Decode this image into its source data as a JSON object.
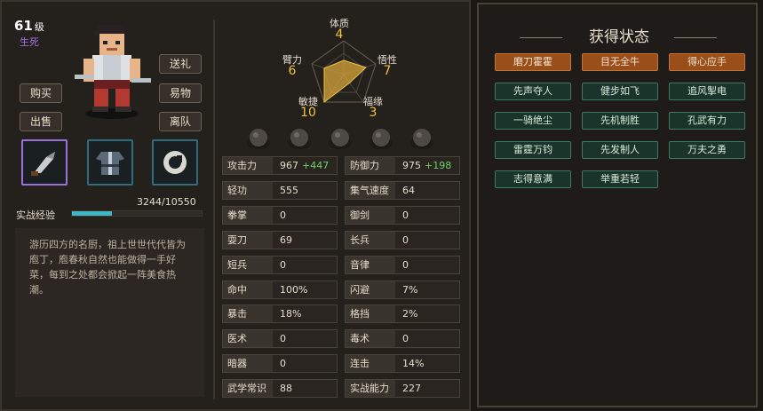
{
  "character": {
    "level": "61",
    "level_unit": "级",
    "status": "生死"
  },
  "buttons": {
    "gift": "送礼",
    "buy": "购买",
    "trade": "易物",
    "sell": "出售",
    "leave": "离队"
  },
  "experience": {
    "label": "实战经验",
    "current": 3244,
    "max": 10550,
    "text": "3244/10550",
    "fill_fraction": 0.307
  },
  "bio": "游历四方的名厨，祖上世世代代皆为庖丁，庖春秋自然也能做得一手好菜，每到之处都会掀起一阵美食热潮。",
  "radar": [
    {
      "label": "体质",
      "value": "4"
    },
    {
      "label": "悟性",
      "value": "7"
    },
    {
      "label": "福缘",
      "value": "3"
    },
    {
      "label": "敏捷",
      "value": "10"
    },
    {
      "label": "臂力",
      "value": "6"
    }
  ],
  "stats_left": [
    {
      "label": "攻击力",
      "value": "967",
      "bonus": "+447"
    },
    {
      "label": "轻功",
      "value": "555",
      "bonus": ""
    },
    {
      "label": "拳掌",
      "value": "0",
      "bonus": ""
    },
    {
      "label": "耍刀",
      "value": "69",
      "bonus": ""
    },
    {
      "label": "短兵",
      "value": "0",
      "bonus": ""
    },
    {
      "label": "命中",
      "value": "100%",
      "bonus": ""
    },
    {
      "label": "暴击",
      "value": "18%",
      "bonus": ""
    },
    {
      "label": "医术",
      "value": "0",
      "bonus": ""
    },
    {
      "label": "暗器",
      "value": "0",
      "bonus": ""
    },
    {
      "label": "武学常识",
      "value": "88",
      "bonus": ""
    }
  ],
  "stats_right": [
    {
      "label": "防御力",
      "value": "975",
      "bonus": "+198"
    },
    {
      "label": "集气速度",
      "value": "64",
      "bonus": ""
    },
    {
      "label": "御剑",
      "value": "0",
      "bonus": ""
    },
    {
      "label": "长兵",
      "value": "0",
      "bonus": ""
    },
    {
      "label": "音律",
      "value": "0",
      "bonus": ""
    },
    {
      "label": "闪避",
      "value": "7%",
      "bonus": ""
    },
    {
      "label": "格挡",
      "value": "2%",
      "bonus": ""
    },
    {
      "label": "毒术",
      "value": "0",
      "bonus": ""
    },
    {
      "label": "连击",
      "value": "14%",
      "bonus": ""
    },
    {
      "label": "实战能力",
      "value": "227",
      "bonus": ""
    }
  ],
  "status_panel": {
    "title": "获得状态",
    "tags": [
      {
        "label": "磨刀霍霍",
        "color": "orange"
      },
      {
        "label": "目无全牛",
        "color": "orange"
      },
      {
        "label": "得心应手",
        "color": "orange"
      },
      {
        "label": "先声夺人",
        "color": "green"
      },
      {
        "label": "健步如飞",
        "color": "green"
      },
      {
        "label": "追风掣电",
        "color": "green"
      },
      {
        "label": "一骑绝尘",
        "color": "green"
      },
      {
        "label": "先机制胜",
        "color": "green"
      },
      {
        "label": "孔武有力",
        "color": "green"
      },
      {
        "label": "雷霆万钧",
        "color": "green"
      },
      {
        "label": "先发制人",
        "color": "green"
      },
      {
        "label": "万夫之勇",
        "color": "green"
      },
      {
        "label": "志得意满",
        "color": "green"
      },
      {
        "label": "举重若轻",
        "color": "green"
      }
    ]
  },
  "colors": {
    "exp_fill": "#3fb7c4",
    "tag_orange": "#9a4e1a",
    "tag_green": "#1b342b",
    "radar_value": "#f0c040",
    "status_purple": "#a872e6"
  },
  "icons": {
    "weapon": "cleaver-icon",
    "armor": "robe-icon",
    "accessory": "ring-icon"
  }
}
